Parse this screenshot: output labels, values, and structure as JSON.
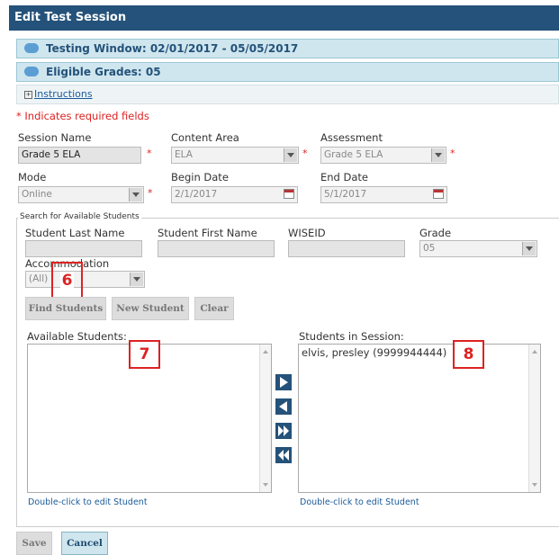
{
  "title": "Edit Test Session",
  "testing_window": "Testing Window: 02/01/2017 - 05/05/2017",
  "eligible_grades": "Eligible Grades: 05",
  "instructions_link": "Instructions",
  "required_note": "* Indicates required fields",
  "fields": {
    "session_name": {
      "label": "Session Name",
      "value": "Grade 5 ELA"
    },
    "content_area": {
      "label": "Content Area",
      "value": "ELA"
    },
    "assessment": {
      "label": "Assessment",
      "value": "Grade 5 ELA"
    },
    "mode": {
      "label": "Mode",
      "value": "Online"
    },
    "begin_date": {
      "label": "Begin Date",
      "value": "2/1/2017"
    },
    "end_date": {
      "label": "End Date",
      "value": "5/1/2017"
    }
  },
  "search": {
    "legend": "Search for Available Students",
    "last_name_label": "Student Last Name",
    "first_name_label": "Student First Name",
    "wiseid_label": "WISEID",
    "grade_label": "Grade",
    "grade_value": "05",
    "accommodation_label": "Accommodation",
    "accommodation_value": "(All)",
    "find_button": "Find Students",
    "new_button": "New Student",
    "clear_button": "Clear"
  },
  "lists": {
    "available_label": "Available Students:",
    "in_session_label": "Students in Session:",
    "in_session_items": [
      "elvis, presley (9999944444)"
    ],
    "hint": "Double-click to edit Student"
  },
  "markers": {
    "m6": "6",
    "m7": "7",
    "m8": "8"
  },
  "footer": {
    "save": "Save",
    "cancel": "Cancel"
  },
  "colors": {
    "header": "#24527a",
    "panel": "#cfe6ee",
    "required": "#dd2222",
    "marker": "#dd2222"
  }
}
